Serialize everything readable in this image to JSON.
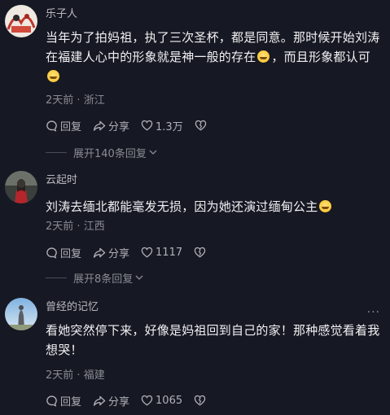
{
  "comments": [
    {
      "user": "乐子人",
      "text_before": "当年为了拍妈祖，执了三次圣杯，都是同意。那时候开始刘涛在福建人心中的形象就是神一般的存在",
      "text_mid": "，而且形象都认可",
      "text_after": "",
      "emoji": "grinning-emoji",
      "time": "2天前",
      "location": "浙江",
      "reply_label": "回复",
      "share_label": "分享",
      "likes": "1.3万",
      "expand_label": "展开140条回复"
    },
    {
      "user": "云起时",
      "text_before": "刘涛去缅北都能毫发无损，因为她还演过缅甸公主",
      "text_mid": "",
      "text_after": "",
      "emoji": "laughing-emoji",
      "time": "2天前",
      "location": "江西",
      "reply_label": "回复",
      "share_label": "分享",
      "likes": "1117",
      "expand_label": "展开8条回复"
    },
    {
      "user": "曾经的记忆",
      "text_before": "看她突然停下来，好像是妈祖回到自己的家！那种感觉看着我想哭！",
      "text_mid": "",
      "text_after": "",
      "time": "2天前",
      "location": "福建",
      "reply_label": "回复",
      "share_label": "分享",
      "likes": "1065"
    }
  ],
  "more_menu": "···",
  "meta_separator": "·",
  "colors": {
    "background": "#161823",
    "text_primary": "#f1f1f3",
    "text_secondary": "#8a8b93"
  }
}
